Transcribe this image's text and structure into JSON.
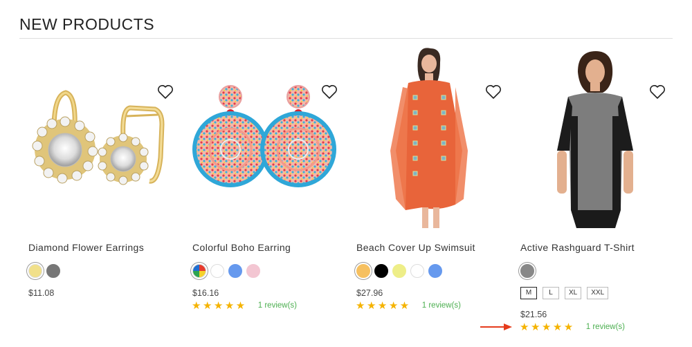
{
  "section": {
    "title": "NEW PRODUCTS"
  },
  "colors": {
    "star": "#f5b301",
    "review_link": "#4caf50",
    "arrow": "#e53b1c"
  },
  "products": [
    {
      "name": "Diamond Flower Earrings",
      "price": "$11.08",
      "swatches": [
        "#f1e08a",
        "#777777"
      ],
      "image_icon": "earrings-icon",
      "wishlist_icon": "heart-outline-icon"
    },
    {
      "name": "Colorful Boho Earring",
      "price": "$16.16",
      "swatches": [
        "multicolor",
        "#ffffff",
        "#6699ee",
        "#f3c6d2"
      ],
      "rating": 5,
      "reviews": "1 review(s)",
      "image_icon": "beaded-earrings-icon",
      "wishlist_icon": "heart-outline-icon"
    },
    {
      "name": "Beach Cover Up Swimsuit",
      "price": "$27.96",
      "swatches": [
        "#f6c060",
        "#000000",
        "#eeee88",
        "#ffffff",
        "#6699ee"
      ],
      "rating": 5,
      "reviews": "1 review(s)",
      "image_icon": "cover-up-dress-icon",
      "wishlist_icon": "heart-outline-icon"
    },
    {
      "name": "Active Rashguard T-Shirt",
      "price": "$21.56",
      "swatches": [
        "#888888"
      ],
      "sizes": [
        "M",
        "L",
        "XL",
        "XXL"
      ],
      "rating": 5,
      "reviews": "1 review(s)",
      "image_icon": "rashguard-shirt-icon",
      "wishlist_icon": "heart-outline-icon"
    }
  ],
  "star_text": "★★★★★"
}
